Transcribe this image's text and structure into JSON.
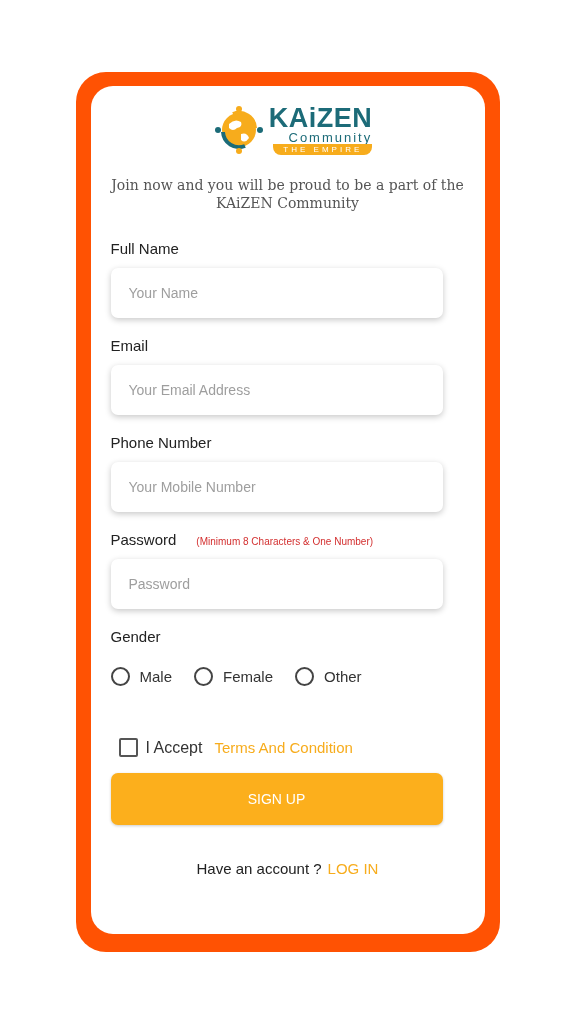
{
  "logo": {
    "name": "KAiZEN",
    "subtitle": "Community",
    "tagline": "THE EMPIRE"
  },
  "intro": "Join now and you will be proud to be a part of the KAiZEN Community",
  "fields": [
    {
      "label": "Full Name",
      "placeholder": "Your Name"
    },
    {
      "label": "Email",
      "placeholder": "Your Email Address"
    },
    {
      "label": "Phone Number",
      "placeholder": "Your Mobile Number"
    },
    {
      "label": "Password",
      "placeholder": "Password",
      "hint": "(Minimum 8 Characters & One Number)"
    }
  ],
  "gender": {
    "label": "Gender",
    "options": [
      {
        "label": "Male",
        "selected": false
      },
      {
        "label": "Female",
        "selected": false
      },
      {
        "label": "Other",
        "selected": false
      }
    ]
  },
  "terms": {
    "checked": false,
    "label": "I Accept",
    "link": "Terms And Condition"
  },
  "submit": "SIGN UP",
  "login": {
    "text": "Have an account ?",
    "link": "LOG IN"
  }
}
